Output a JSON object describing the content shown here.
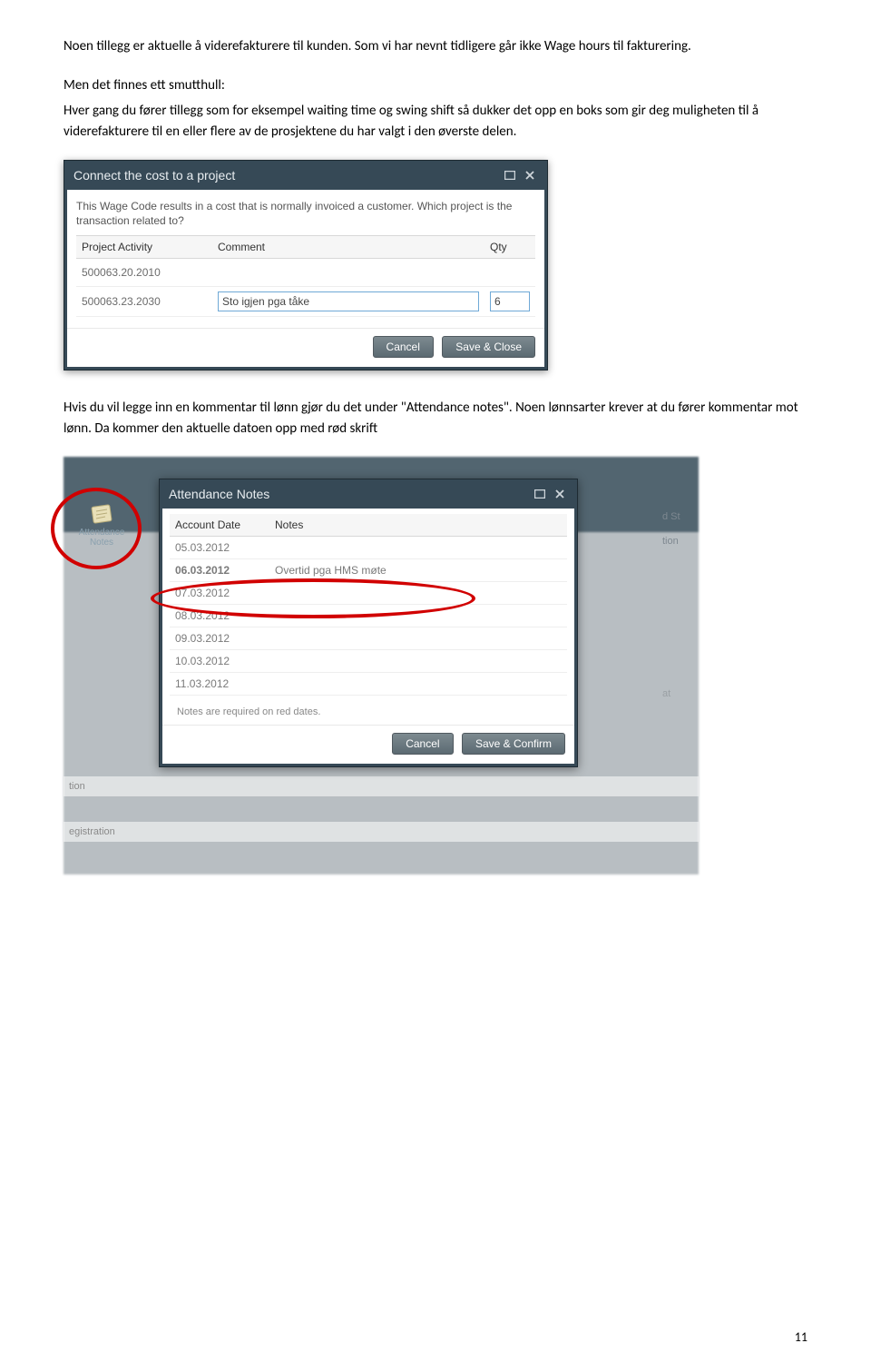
{
  "paragraphs": {
    "p1": "Noen tillegg er aktuelle å viderefakturere til kunden. Som vi har nevnt tidligere går ikke Wage hours til fakturering.",
    "p2": "Men det finnes ett smutthull:",
    "p3": "Hver gang du fører tillegg som for eksempel waiting time og swing shift så dukker det opp en boks som gir deg muligheten til å viderefakturere til en eller flere av de prosjektene du har valgt i den øverste delen.",
    "p4": "Hvis du vil legge inn en kommentar til lønn gjør du det under \"Attendance notes\". Noen lønnsarter krever at du fører kommentar mot lønn. Da kommer den aktuelle datoen opp med rød skrift"
  },
  "dialog1": {
    "title": "Connect the cost to a project",
    "intro": "This Wage Code results in a cost that is normally invoiced a customer. Which project is the transaction related to?",
    "headers": {
      "c1": "Project Activity",
      "c2": "Comment",
      "c3": "Qty"
    },
    "rows": [
      {
        "activity": "500063.20.2010",
        "comment": "",
        "qty": ""
      },
      {
        "activity": "500063.23.2030",
        "comment": "Sto igjen pga tåke",
        "qty": "6"
      }
    ],
    "buttons": {
      "cancel": "Cancel",
      "save": "Save & Close"
    }
  },
  "attendance_button": {
    "line1": "Attendance",
    "line2": "Notes"
  },
  "dialog2": {
    "title": "Attendance Notes",
    "headers": {
      "c1": "Account Date",
      "c2": "Notes"
    },
    "rows": [
      {
        "date": "05.03.2012",
        "note": "",
        "red": false
      },
      {
        "date": "06.03.2012",
        "note": "Overtid pga HMS møte",
        "red": true
      },
      {
        "date": "07.03.2012",
        "note": "",
        "red": false
      },
      {
        "date": "08.03.2012",
        "note": "",
        "red": false
      },
      {
        "date": "09.03.2012",
        "note": "",
        "red": false
      },
      {
        "date": "10.03.2012",
        "note": "",
        "red": false
      },
      {
        "date": "11.03.2012",
        "note": "",
        "red": false
      }
    ],
    "footer": "Notes are required on red dates.",
    "buttons": {
      "cancel": "Cancel",
      "save": "Save & Confirm"
    }
  },
  "bg_labels": {
    "dst": "d St",
    "tion1": "tion",
    "at": "at",
    "tion2": "tion",
    "egistration": "egistration"
  },
  "page_number": "11"
}
